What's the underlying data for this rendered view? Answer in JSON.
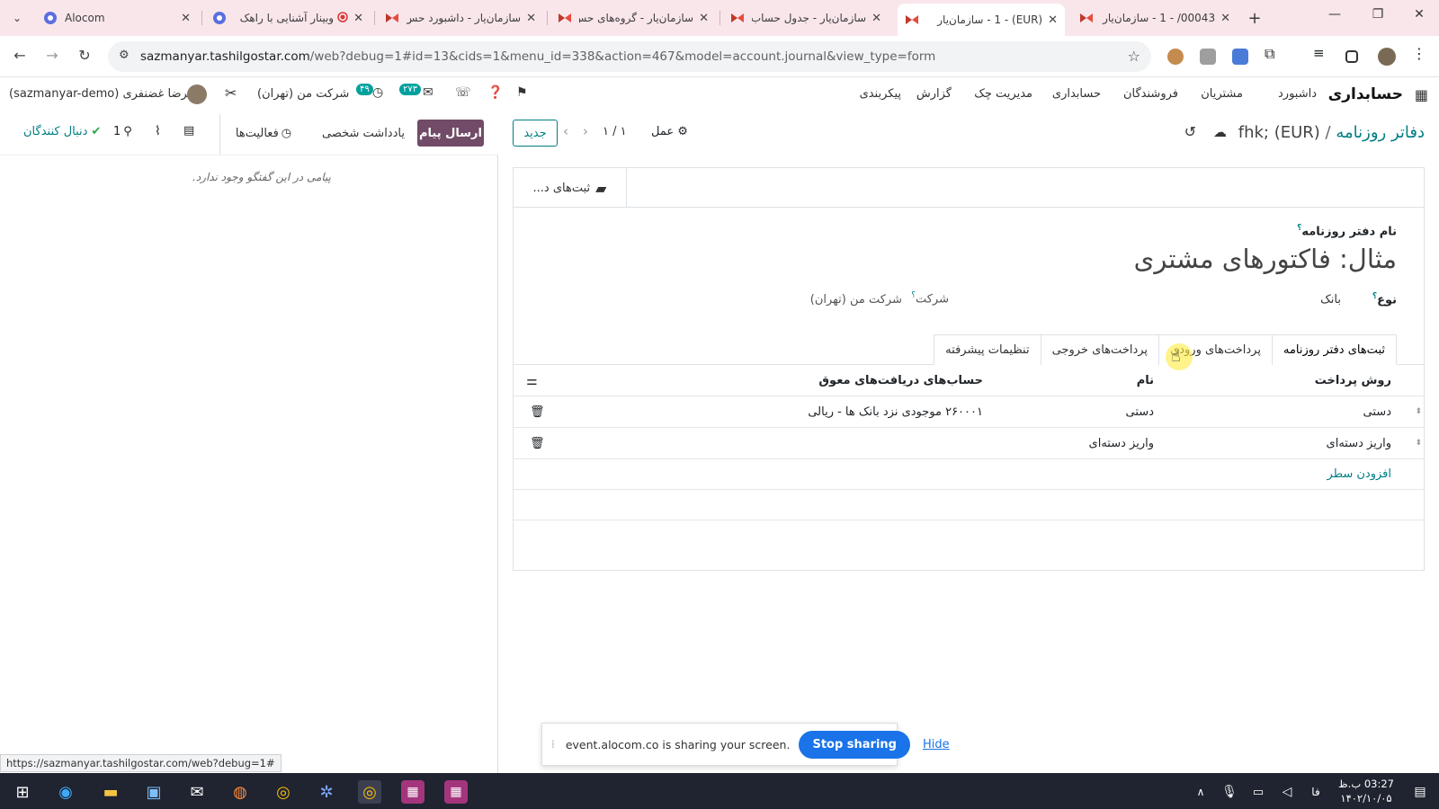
{
  "browser": {
    "tabs": [
      {
        "title": "Alocom",
        "active": false
      },
      {
        "title": "وبینار آشنایی با راهک",
        "active": false
      },
      {
        "title": "سازمان‌یار - داشبورد حس",
        "active": false
      },
      {
        "title": "سازمان‌یار - گروه‌های حس",
        "active": false
      },
      {
        "title": "سازمان‌یار - جدول حساب",
        "active": false
      },
      {
        "title": "(EUR) - 1 - سازمان‌یار",
        "active": true
      },
      {
        "title": "00043/ - 1 - سازمان‌یار",
        "active": false
      }
    ],
    "url_domain": "sazmanyar.tashilgostar.com",
    "url_path": "/web?debug=1#id=13&cids=1&menu_id=338&action=467&model=account.journal&view_type=form",
    "status_url": "https://sazmanyar.tashilgostar.com/web?debug=1#"
  },
  "odoo": {
    "app_name": "حسابداری",
    "menus": [
      "داشبورد",
      "مشتریان",
      "فروشندگان",
      "حسابداری",
      "مدیریت چک",
      "گزارش",
      "پیکربندی"
    ],
    "user": "علیرضا غضنفری (sazmanyar-demo)",
    "company": "شرکت من (تهران)",
    "badge_activity": "۴۹",
    "badge_messages": "۲۷۳"
  },
  "control": {
    "breadcrumb_parent": "دفاتر روزنامه",
    "breadcrumb_sep": "/",
    "breadcrumb_current": "fhk; (EUR)",
    "action_label": "عمل",
    "pager": "۱ / ۱",
    "new_label": "جدید"
  },
  "chatter": {
    "send_message": "ارسال پیام",
    "log_note": "یادداشت شخصی",
    "activities": "فعالیت‌ها",
    "followers_count": "1",
    "follow_label": "دنبال کنندگان",
    "empty_text": "پیامی در این گفتگو وجود ندارد."
  },
  "form": {
    "smart_button": "ثبت‌های د...",
    "name_label": "نام دفتر روزنامه",
    "name_placeholder": "مثال: فاکتورهای مشتری",
    "type_label": "نوع",
    "type_value": "بانک",
    "company_label": "شرکت",
    "company_value": "شرکت من (تهران)",
    "help_mark": "؟",
    "tabs": [
      "ثبت‌های دفتر روزنامه",
      "پرداخت‌های ورودی",
      "پرداخت‌های خروجی",
      "تنظیمات پیشرفته"
    ],
    "table": {
      "headers": {
        "method": "روش پرداخت",
        "name": "نام",
        "account": "حساب‌های دریافت‌های معوق"
      },
      "rows": [
        {
          "method": "دستی",
          "name": "دستی",
          "account": "۲۶۰۰۰۱ موجودی نزد بانک ها - ریالی"
        },
        {
          "method": "واریز دسته‌ای",
          "name": "واریز دسته‌ای",
          "account": ""
        }
      ],
      "add_line": "افزودن سطر"
    }
  },
  "share": {
    "text": "event.alocom.co is sharing your screen.",
    "stop": "Stop sharing",
    "hide": "Hide"
  },
  "taskbar": {
    "time": "03:27 ب.ظ",
    "date": "۱۴۰۲/۱۰/۰۵",
    "lang": "فا"
  }
}
